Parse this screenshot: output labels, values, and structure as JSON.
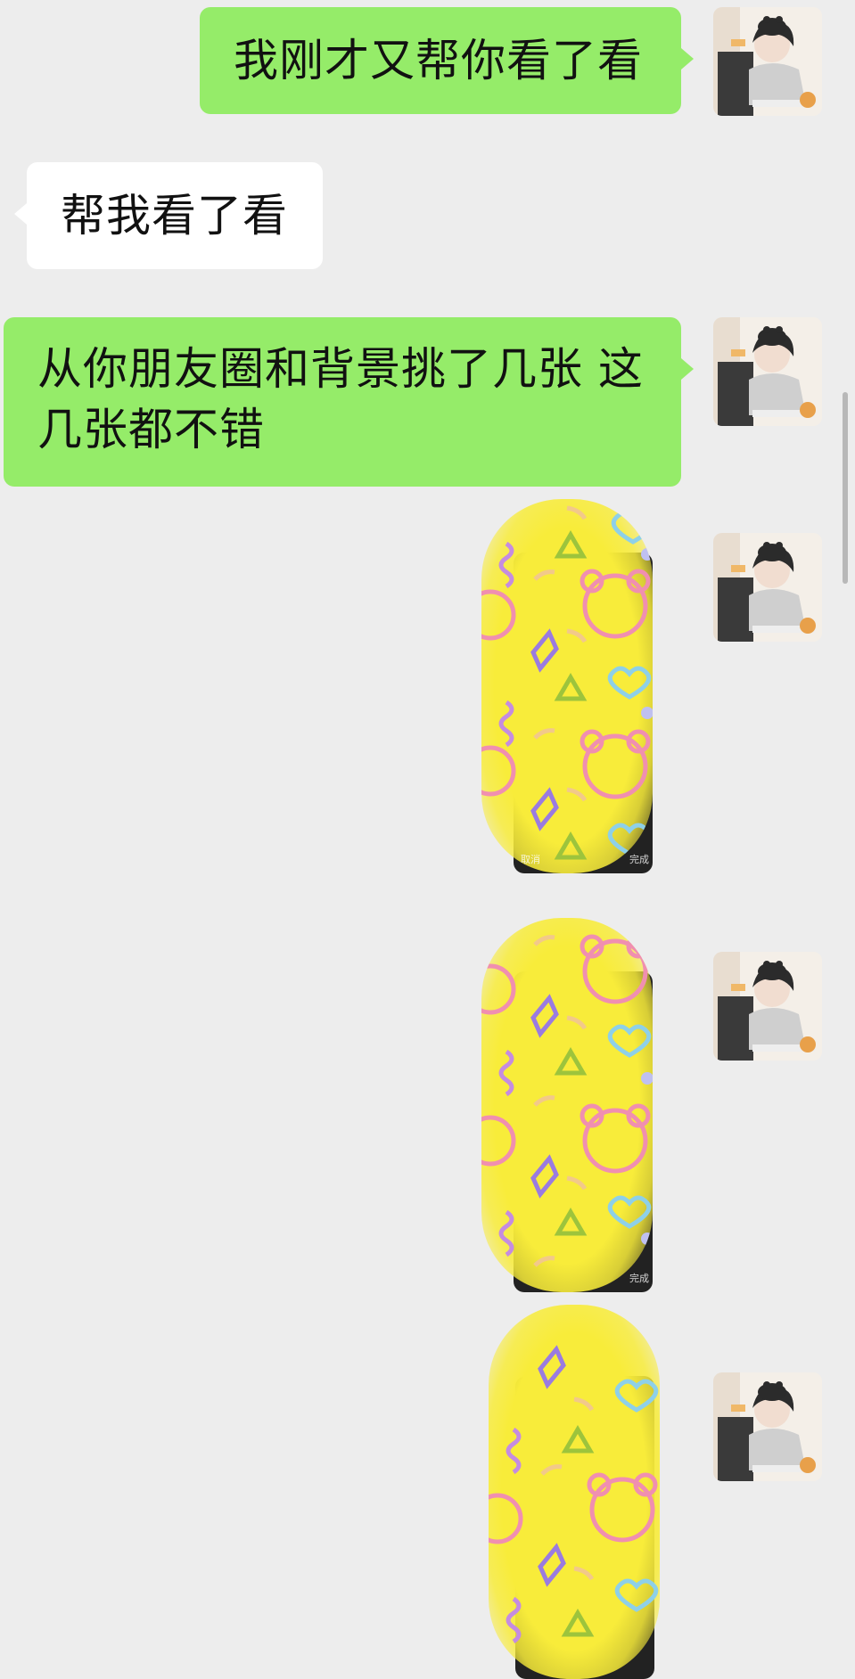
{
  "colors": {
    "background": "#ededed",
    "outgoing_bubble": "#95ec69",
    "incoming_bubble": "#ffffff",
    "pattern_yellow": "#f8ec3a"
  },
  "messages": [
    {
      "type": "text",
      "direction": "outgoing",
      "text": "我刚才又帮你看了看"
    },
    {
      "type": "text",
      "direction": "incoming",
      "text": "帮我看了看"
    },
    {
      "type": "text",
      "direction": "outgoing",
      "text": "从你朋友圈和背景挑了几张 这几张都不错"
    },
    {
      "type": "image",
      "direction": "outgoing",
      "description_icon": "yellow-bear-pattern-image",
      "caption_left": "取消",
      "caption_right": "完成"
    },
    {
      "type": "image",
      "direction": "outgoing",
      "description_icon": "yellow-bear-pattern-image",
      "caption_left": "",
      "caption_right": "完成"
    },
    {
      "type": "image",
      "direction": "outgoing",
      "description_icon": "yellow-bear-pattern-image",
      "caption_left": "",
      "caption_right": ""
    }
  ],
  "avatar_icon": "girl-with-cat-avatar"
}
